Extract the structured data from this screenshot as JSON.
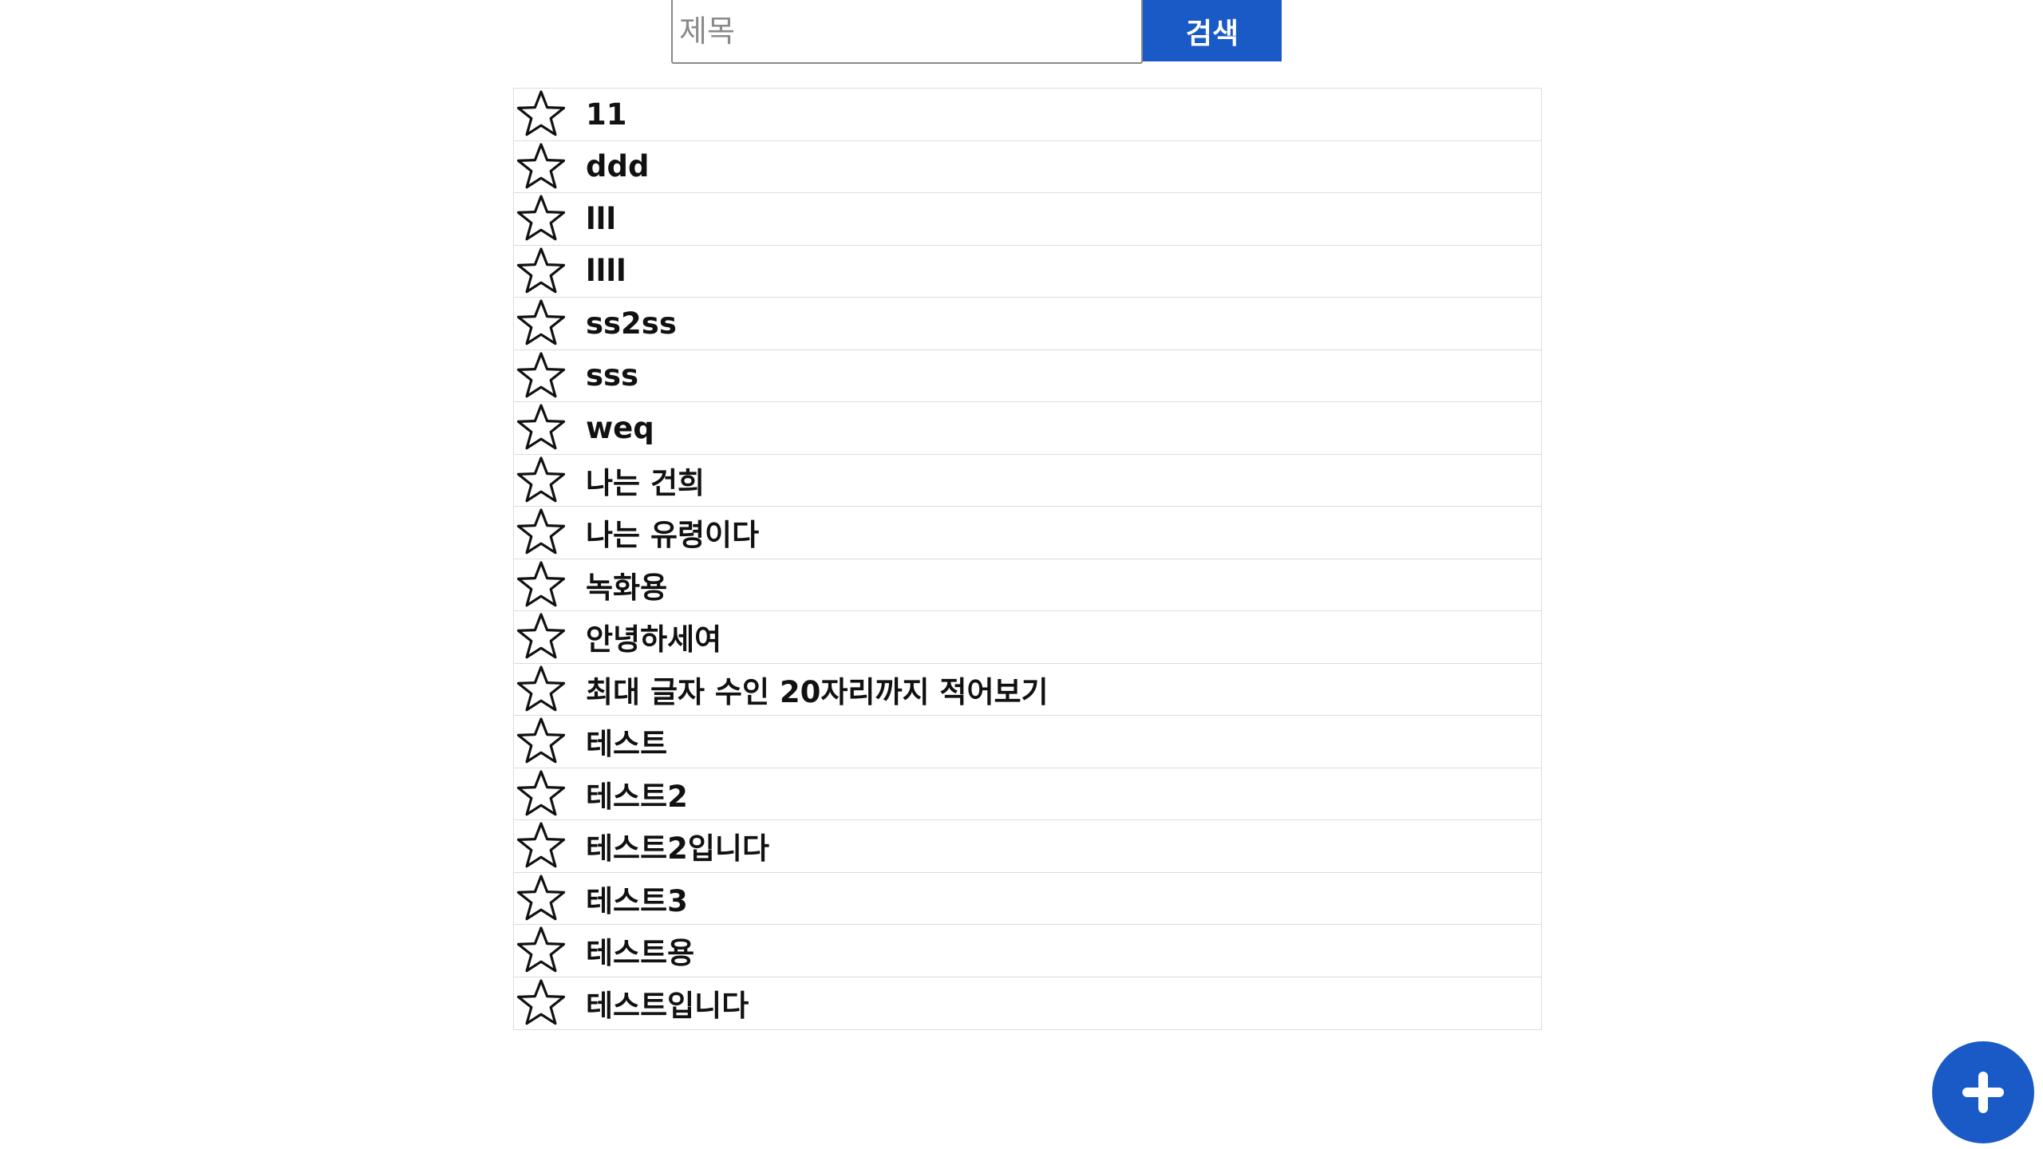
{
  "search": {
    "placeholder": "제목",
    "value": "",
    "button_label": "검색"
  },
  "list": {
    "items": [
      {
        "title": "11",
        "starred": false
      },
      {
        "title": "ddd",
        "starred": false
      },
      {
        "title": "lll",
        "starred": false
      },
      {
        "title": "llll",
        "starred": false
      },
      {
        "title": "ss2ss",
        "starred": false
      },
      {
        "title": "sss",
        "starred": false
      },
      {
        "title": "weq",
        "starred": false
      },
      {
        "title": "나는 건희",
        "starred": false
      },
      {
        "title": "나는 유령이다",
        "starred": false
      },
      {
        "title": "녹화용",
        "starred": false
      },
      {
        "title": "안녕하세여",
        "starred": false
      },
      {
        "title": "최대 글자 수인 20자리까지 적어보기",
        "starred": false
      },
      {
        "title": "테스트",
        "starred": false
      },
      {
        "title": "테스트2",
        "starred": false
      },
      {
        "title": "테스트2입니다",
        "starred": false
      },
      {
        "title": "테스트3",
        "starred": false
      },
      {
        "title": "테스트용",
        "starred": false
      },
      {
        "title": "테스트입니다",
        "starred": false
      }
    ]
  },
  "icons": {
    "star": "star-outline-icon",
    "add": "plus-icon"
  },
  "colors": {
    "accent": "#1a5ac6",
    "border": "#dcdcdc",
    "text": "#111111"
  }
}
